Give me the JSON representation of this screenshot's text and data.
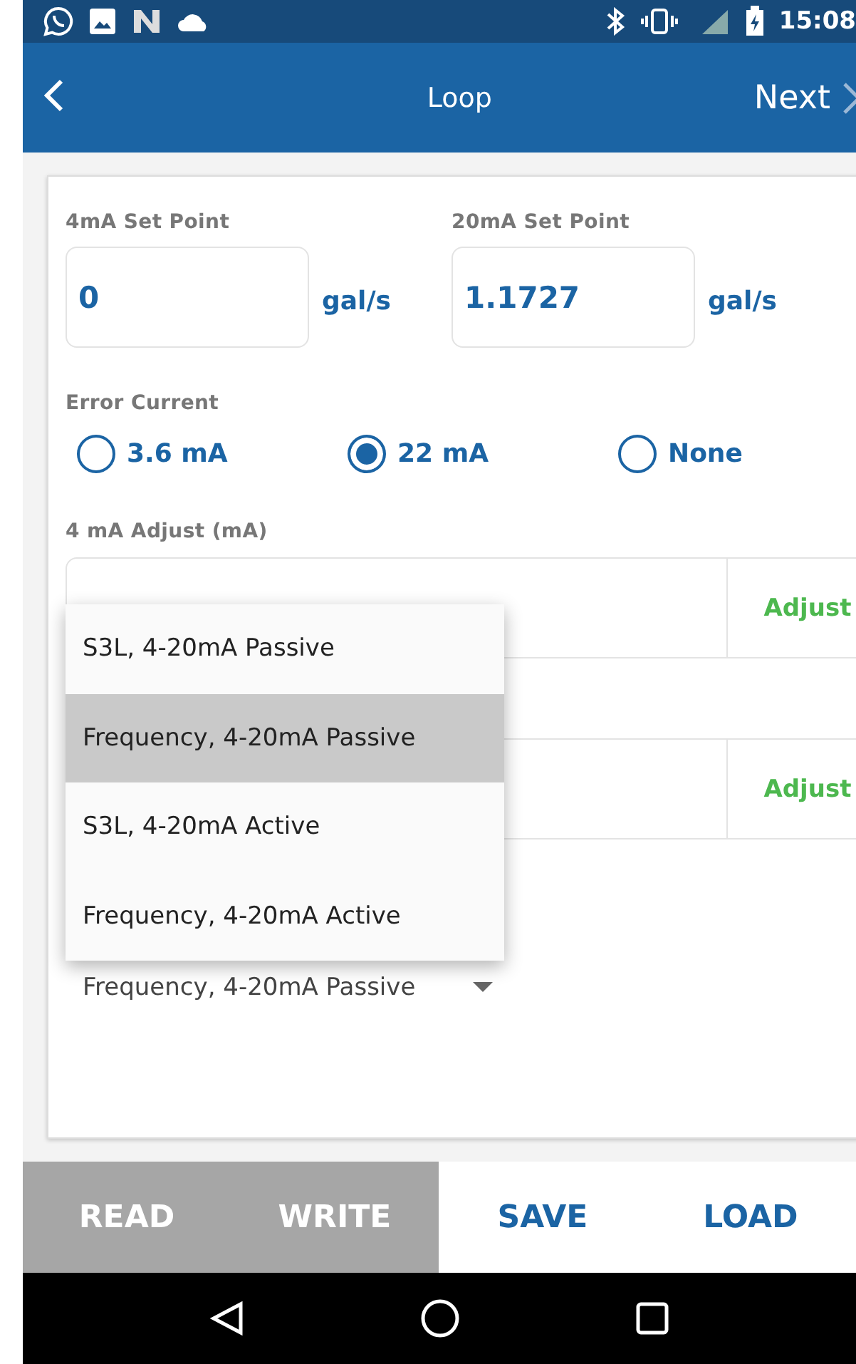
{
  "status_bar": {
    "time": "15:08"
  },
  "header": {
    "title": "Loop",
    "next": "Next"
  },
  "setpoints": [
    {
      "label": "4mA Set Point",
      "value": "0",
      "unit": "gal/s"
    },
    {
      "label": "20mA Set Point",
      "value": "1.1727",
      "unit": "gal/s"
    }
  ],
  "error_current": {
    "label": "Error Current",
    "options": [
      {
        "label": "3.6 mA",
        "selected": false
      },
      {
        "label": "22 mA",
        "selected": true
      },
      {
        "label": "None",
        "selected": false
      }
    ]
  },
  "adjust_4ma": {
    "label": "4 mA Adjust (mA)",
    "button": "Adjust"
  },
  "adjust_20ma": {
    "button": "Adjust"
  },
  "output_select": {
    "value": "Frequency, 4-20mA Passive"
  },
  "dropdown": [
    {
      "label": "S3L, 4-20mA Passive",
      "selected": false
    },
    {
      "label": "Frequency, 4-20mA Passive",
      "selected": true
    },
    {
      "label": "S3L, 4-20mA Active",
      "selected": false
    },
    {
      "label": "Frequency, 4-20mA Active",
      "selected": false
    }
  ],
  "actions": [
    {
      "label": "READ",
      "disabled": true
    },
    {
      "label": "WRITE",
      "disabled": true
    },
    {
      "label": "SAVE",
      "disabled": false
    },
    {
      "label": "LOAD",
      "disabled": false
    }
  ]
}
